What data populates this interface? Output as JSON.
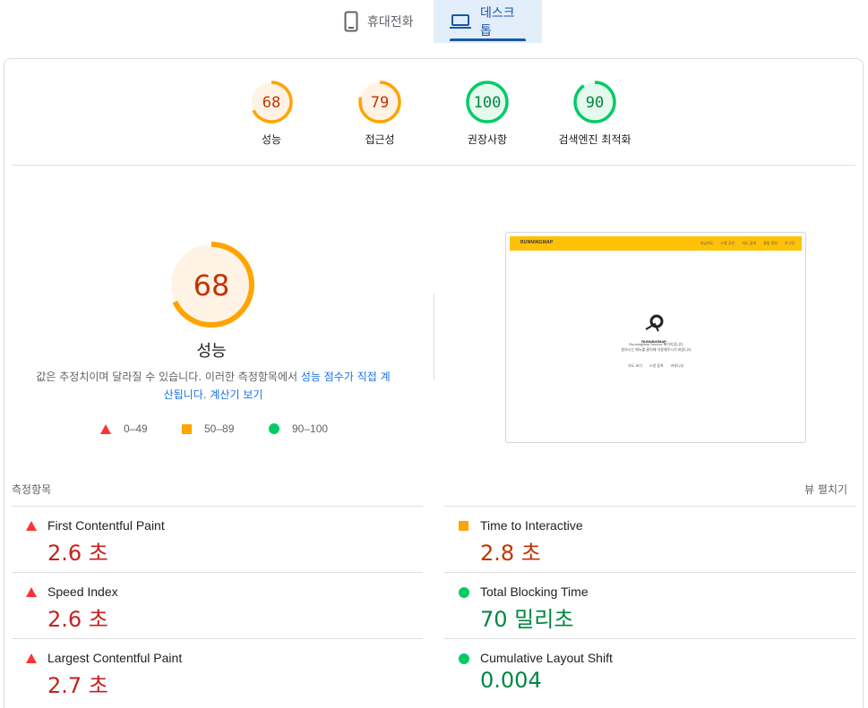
{
  "tabs": {
    "mobile": "휴대전화",
    "desktop": "데스크톱"
  },
  "summary": [
    {
      "score": "68",
      "label": "성능",
      "value": 68,
      "status": "average"
    },
    {
      "score": "79",
      "label": "접근성",
      "value": 79,
      "status": "average"
    },
    {
      "score": "100",
      "label": "권장사항",
      "value": 100,
      "status": "pass"
    },
    {
      "score": "90",
      "label": "검색엔진 최적화",
      "value": 90,
      "status": "pass"
    }
  ],
  "performance": {
    "score": "68",
    "value": 68,
    "title": "성능",
    "desc_prefix": "값은 추정치이며 달라질 수 있습니다. 이러한 측정항목에서 ",
    "desc_link1": "성능 점수가 직접 계산됩니다.",
    "desc_link2": "계산기 보기",
    "legend": {
      "fail": "0–49",
      "average": "50–89",
      "pass": "90–100"
    }
  },
  "thumbnail": {
    "logo": "RUNNINGMAP",
    "nav": [
      "러닝지도",
      "스팟 공유",
      "지도 검색",
      "클럽 정보",
      "로그인"
    ],
    "center_logo": "RUNNINGMAP",
    "center_lines": [
      "RunningMap Service 페이지입니다.",
      "원하시는 메뉴를 클릭해 이용해주시기 바랍니다."
    ],
    "links": [
      "지도 보기",
      "스팟 등록",
      "커뮤니티"
    ]
  },
  "metrics_header": {
    "title": "측정항목",
    "expand": "뷰 펼치기"
  },
  "metrics": [
    {
      "label": "First Contentful Paint",
      "value": "2.6 초",
      "status": "fail"
    },
    {
      "label": "Time to Interactive",
      "value": "2.8 초",
      "status": "average"
    },
    {
      "label": "Speed Index",
      "value": "2.6 초",
      "status": "fail"
    },
    {
      "label": "Total Blocking Time",
      "value": "70 밀리초",
      "status": "pass"
    },
    {
      "label": "Largest Contentful Paint",
      "value": "2.7 초",
      "status": "fail"
    },
    {
      "label": "Cumulative Layout Shift",
      "value": "0.004",
      "status": "pass"
    }
  ],
  "colors": {
    "fail": "#c5221f",
    "average": "#c33300",
    "pass": "#018642",
    "average_ring": "#ffa400",
    "pass_ring": "#0c6",
    "average_bg": "#fff3e6",
    "pass_bg": "#e6f9ee"
  }
}
